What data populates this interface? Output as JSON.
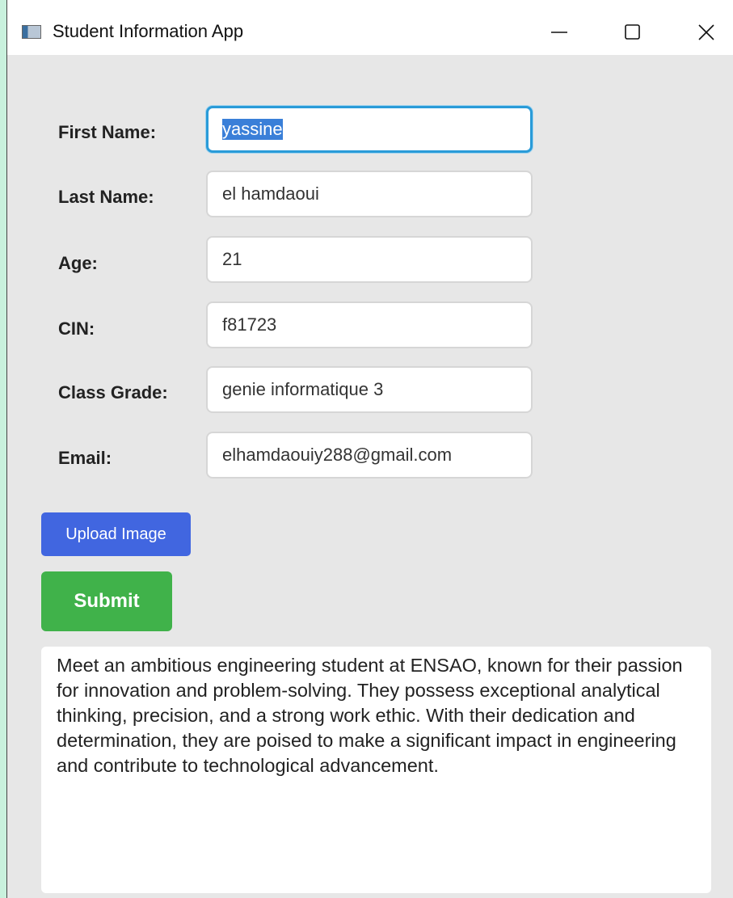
{
  "window": {
    "title": "Student Information App"
  },
  "form": {
    "first_name": {
      "label": "First Name:",
      "value": "yassine"
    },
    "last_name": {
      "label": "Last Name:",
      "value": "el hamdaoui"
    },
    "age": {
      "label": "Age:",
      "value": "21"
    },
    "cin": {
      "label": "CIN:",
      "value": "f81723"
    },
    "class_grade": {
      "label": "Class Grade:",
      "value": "genie informatique 3"
    },
    "email": {
      "label": "Email:",
      "value": "elhamdaouiy288@gmail.com"
    }
  },
  "buttons": {
    "upload_label": "Upload Image",
    "submit_label": "Submit"
  },
  "bio": {
    "text": "Meet an ambitious engineering student at ENSAO, known for their passion for innovation and problem-solving. They possess exceptional analytical thinking, precision, and a strong work ethic. With their dedication and determination, they are poised to make a significant impact in engineering and contribute to technological advancement."
  },
  "colors": {
    "upload_button": "#4166e0",
    "submit_button": "#40b24a",
    "focus_border": "#2a9bd8",
    "text_selection": "#3a7fd8",
    "window_background": "#e7e7e7"
  },
  "icons": {
    "app": "app-window-icon",
    "minimize": "minimize-icon",
    "maximize": "maximize-icon",
    "close": "close-icon"
  }
}
